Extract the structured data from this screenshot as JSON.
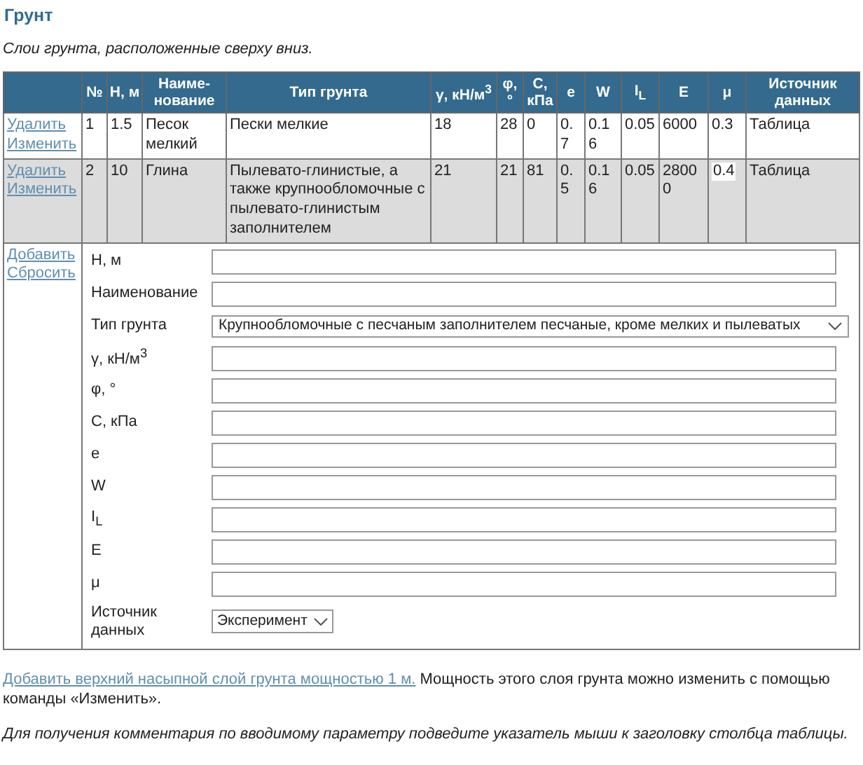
{
  "title": "Грунт",
  "subtitle": "Слои грунта, расположенные сверху вниз.",
  "table": {
    "columns": [
      "№",
      "H, м",
      "Наиме-нование",
      "Тип грунта",
      "γ, кН/м$^{3}$",
      "φ, °",
      "C, кПа",
      "e",
      "W",
      "I$_{L}$",
      "E",
      "μ",
      "Источник данных"
    ],
    "rows": [
      {
        "selected": false,
        "actions": [
          "Удалить",
          "Изменить"
        ],
        "cells": [
          {
            "kind": "text",
            "text": "1"
          },
          {
            "kind": "text",
            "text": "1.5"
          },
          {
            "kind": "text",
            "text": "Песок мелкий"
          },
          {
            "kind": "text",
            "text": "Пески мелкие"
          },
          {
            "kind": "text",
            "text": "18"
          },
          {
            "kind": "text",
            "text": "28"
          },
          {
            "kind": "text",
            "text": "0"
          },
          {
            "kind": "text",
            "text": "0.7"
          },
          {
            "kind": "text",
            "text": "0.16"
          },
          {
            "kind": "text",
            "text": "0.05"
          },
          {
            "kind": "text",
            "text": "6000"
          },
          {
            "kind": "text",
            "text": "0.3"
          },
          {
            "kind": "text",
            "text": "Таблица"
          }
        ]
      },
      {
        "selected": true,
        "actions": [
          "Удалить",
          "Изменить"
        ],
        "cells": [
          {
            "kind": "text",
            "text": "2"
          },
          {
            "kind": "text",
            "text": "10"
          },
          {
            "kind": "text",
            "text": "Глина"
          },
          {
            "kind": "text",
            "text": "Пылевато-глинистые, а также крупнообломочные с пылевато-глинистым заполнителем"
          },
          {
            "kind": "text",
            "text": "21"
          },
          {
            "kind": "text",
            "text": "21"
          },
          {
            "kind": "text",
            "text": "81"
          },
          {
            "kind": "text",
            "text": "0.5"
          },
          {
            "kind": "text",
            "text": "0.16"
          },
          {
            "kind": "text",
            "text": "0.05"
          },
          {
            "kind": "text",
            "text": "28000"
          },
          {
            "kind": "input",
            "text": "0.4"
          },
          {
            "kind": "text",
            "text": "Таблица"
          }
        ]
      }
    ]
  },
  "form": {
    "actions": [
      "Добавить",
      "Сбросить"
    ],
    "fields": [
      {
        "label": "H, м",
        "kind": "input"
      },
      {
        "label": "Наименование",
        "kind": "input"
      },
      {
        "label": "Тип грунта",
        "kind": "select",
        "value": "Крупнообломочные с песчаным заполнителем песчаные, кроме мелких и пылеватых"
      },
      {
        "label": "γ, кН/м$^{3}$",
        "kind": "input"
      },
      {
        "label": "φ, °",
        "kind": "input"
      },
      {
        "label": "C, кПа",
        "kind": "input"
      },
      {
        "label": "e",
        "kind": "input"
      },
      {
        "label": "W",
        "kind": "input"
      },
      {
        "label": "I$_{L}$",
        "kind": "input"
      },
      {
        "label": "E",
        "kind": "input"
      },
      {
        "label": "μ",
        "kind": "input"
      },
      {
        "label": "Источник данных",
        "kind": "small-select",
        "value": "Эксперимент"
      }
    ]
  },
  "note": {
    "link": "Добавить верхний насыпной слой грунта мощностью 1 м.",
    "text": "Мощность этого слоя грунта можно изменить с помощью команды «Изменить»."
  },
  "hint": "Для получения комментария по вводимому параметру подведите указатель мыши к заголовку столбца таблицы."
}
